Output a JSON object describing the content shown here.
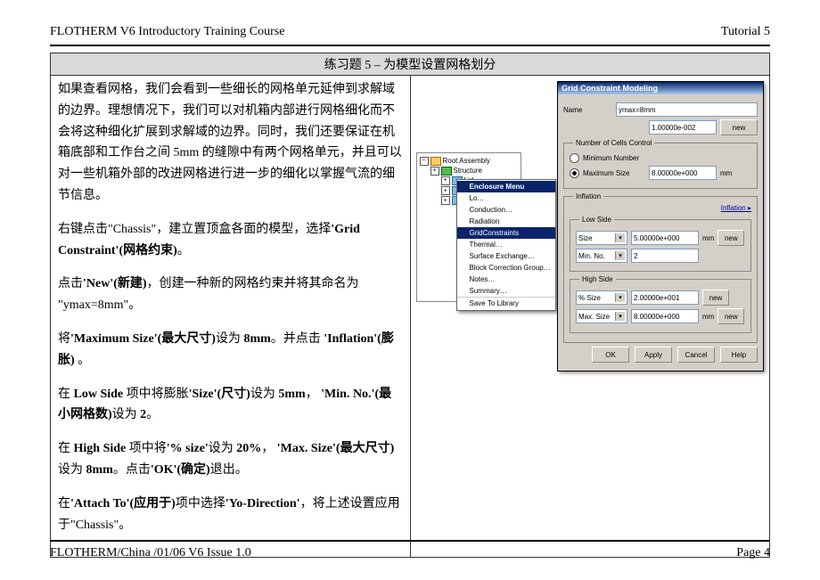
{
  "header": {
    "left": "FLOTHERM V6 Introductory Training Course",
    "right": "Tutorial 5"
  },
  "banner": "练习题 5 – 为模型设置网格划分",
  "body": {
    "p1": "如果查看网格，我们会看到一些细长的网格单元延伸到求解域的边界。理想情况下，我们可以对机箱内部进行网格细化而不会将这种细化扩展到求解域的边界。同时，我们还要保证在机箱底部和工作台之间 5mm 的缝隙中有两个网格单元，并且可以对一些机箱外部的改进网格进行进一步的细化以掌握气流的细节信息。",
    "p2a": "右键点击\"Chassis\"，建立置顶盒各面的模型，选择",
    "p2b_en1": "'Grid Constraint'",
    "p2b_cn": "(网格约束)",
    "p2c": "。",
    "p3a": "点击",
    "p3_new_en": "'New'",
    "p3_new_cn": "(新建)",
    "p3b": "，创建一种新的网格约束并将其命名为",
    "p3c": "\"ymax=8mm\"。",
    "p4a": "将",
    "p4_ms_en": "'Maximum Size'",
    "p4_ms_cn": "(最大尺寸)",
    "p4b": "设为 ",
    "p4v": "8mm",
    "p4c": "。并点击",
    "p4_inf_en": "'Inflation'",
    "p4_inf_cn": "(膨胀)",
    "p4d": " 。",
    "p5a": "在 ",
    "p5_ls": "Low Side",
    "p5b": " 项中将膨胀",
    "p5_size_en": "'Size'",
    "p5_size_cn": "(尺寸)",
    "p5c": "设为 ",
    "p5v1": "5mm",
    "p5d": "，",
    "p5_min_en": "'Min. No.'",
    "p5_min_cn": "(最小网格数)",
    "p5e": "设为 ",
    "p5v2": "2",
    "p5f": "。",
    "p6a": "在 ",
    "p6_hs": "High Side",
    "p6b": " 项中将",
    "p6_ps_en": "'% size'",
    "p6c": "设为 ",
    "p6v1": "20%",
    "p6d": "，",
    "p6_ms_en": "'Max. Size'",
    "p6_ms_cn": "(最大尺寸)",
    "p6e": "设为 ",
    "p6v2": "8mm",
    "p6f": "。点击",
    "p6_ok_en": "'OK'",
    "p6_ok_cn": "(确定)",
    "p6g": "退出。",
    "p7a": "在",
    "p7_at_en": "'Attach To'",
    "p7_at_cn": "(应用于)",
    "p7b": "项中选择",
    "p7_yo_en": "'Yo-Direction'",
    "p7c": "，将上述设置应用于\"Chassis\"。"
  },
  "tree": {
    "root": "Root Assembly",
    "structure": "Structure",
    "lid": "Lid",
    "lo": "Lo…",
    "conduction": "Conduction…",
    "electrics": "Radiation",
    "gc": "GridConstraints",
    "thermal": "Thermal…",
    "surface": "Surface Exchange…",
    "block": "Block Correction Group…",
    "notes": "Notes…",
    "summary": "Summary…",
    "save": "Save To Library",
    "menu_title": "Enclosure Menu"
  },
  "dialog": {
    "title": "Grid Constraint Modeling",
    "name_lbl": "Name",
    "name_val": "ymax=8mm",
    "num_cells": "Number of Cells Control",
    "min_num": "Minimum Number",
    "max_size": "Maximum Size",
    "maxv": "1.00000e-002",
    "maxv2": "8.00000e+000",
    "unit": "mm",
    "inflation_lbl": "Inflation",
    "inflation_link": "Inflation ▸",
    "low_side": "Low Side",
    "high_side": "High Side",
    "size_lbl": "Size",
    "minno_lbl": "Min. No.",
    "psize_lbl": "% Size",
    "maxsize_lbl": "Max. Size",
    "low_size": "5.00000e+000",
    "low_min": "2",
    "high_ps": "2.00000e+001",
    "high_ms": "8.00000e+000",
    "new_btn": "new",
    "ok": "OK",
    "apply": "Apply",
    "cancel": "Cancel",
    "help": "Help"
  },
  "footer": {
    "left": "FLOTHERM/China /01/06 V6 Issue 1.0",
    "right": "Page 4"
  }
}
